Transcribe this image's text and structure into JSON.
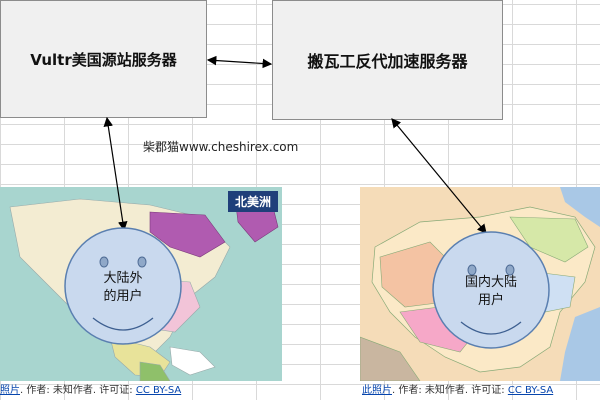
{
  "diagram": {
    "left_box_label": "Vultr美国源站服务器",
    "right_box_label": "搬瓦工反代加速服务器",
    "watermark": "柴郡猫www.cheshirex.com",
    "left_map_region": "北美洲",
    "left_user_line1": "大陆外",
    "left_user_line2": "的用户",
    "right_user_line1": "国内大陆",
    "right_user_line2": "用户"
  },
  "captions": {
    "left": {
      "photo_link": "照片",
      "author": "作者: 未知作者.",
      "license_label": "许可证:",
      "license_link": "CC BY-SA"
    },
    "right": {
      "photo_link": "此照片",
      "author": "作者: 未知作者.",
      "license_label": "许可证:",
      "license_link": "CC BY-SA"
    }
  },
  "colors": {
    "face_fill": "#c9d9ee",
    "face_stroke": "#5a7fb0",
    "ocean": "#a8d5cf",
    "arrow": "#000000"
  }
}
